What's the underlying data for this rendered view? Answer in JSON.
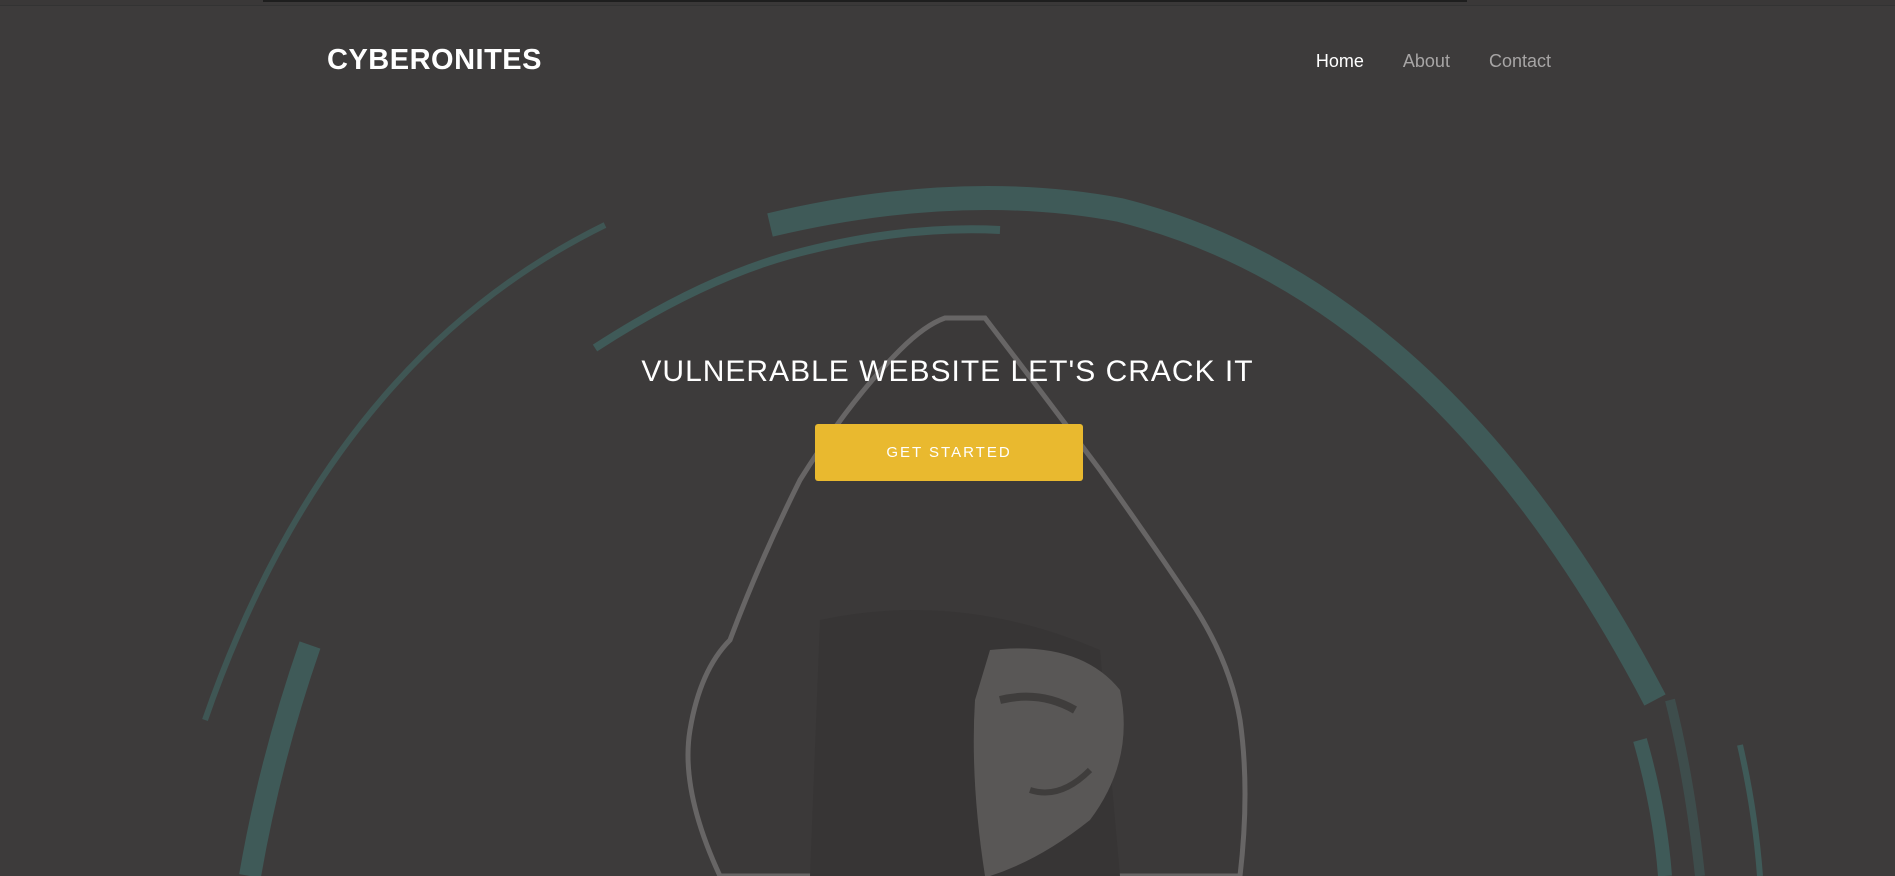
{
  "header": {
    "brand": "CYBERONITES",
    "nav": [
      {
        "label": "Home",
        "active": true
      },
      {
        "label": "About",
        "active": false
      },
      {
        "label": "Contact",
        "active": false
      }
    ]
  },
  "hero": {
    "title": "VULNERABLE WEBSITE LET'S CRACK IT",
    "cta_label": "GET STARTED",
    "background_graphic": "hooded-figure-with-mask-and-teal-rings"
  },
  "colors": {
    "background": "#3d3b3b",
    "ring_accent": "#3f5a58",
    "cta": "#e9b92f",
    "text": "#ffffff",
    "nav_inactive": "#a7a5a5"
  }
}
